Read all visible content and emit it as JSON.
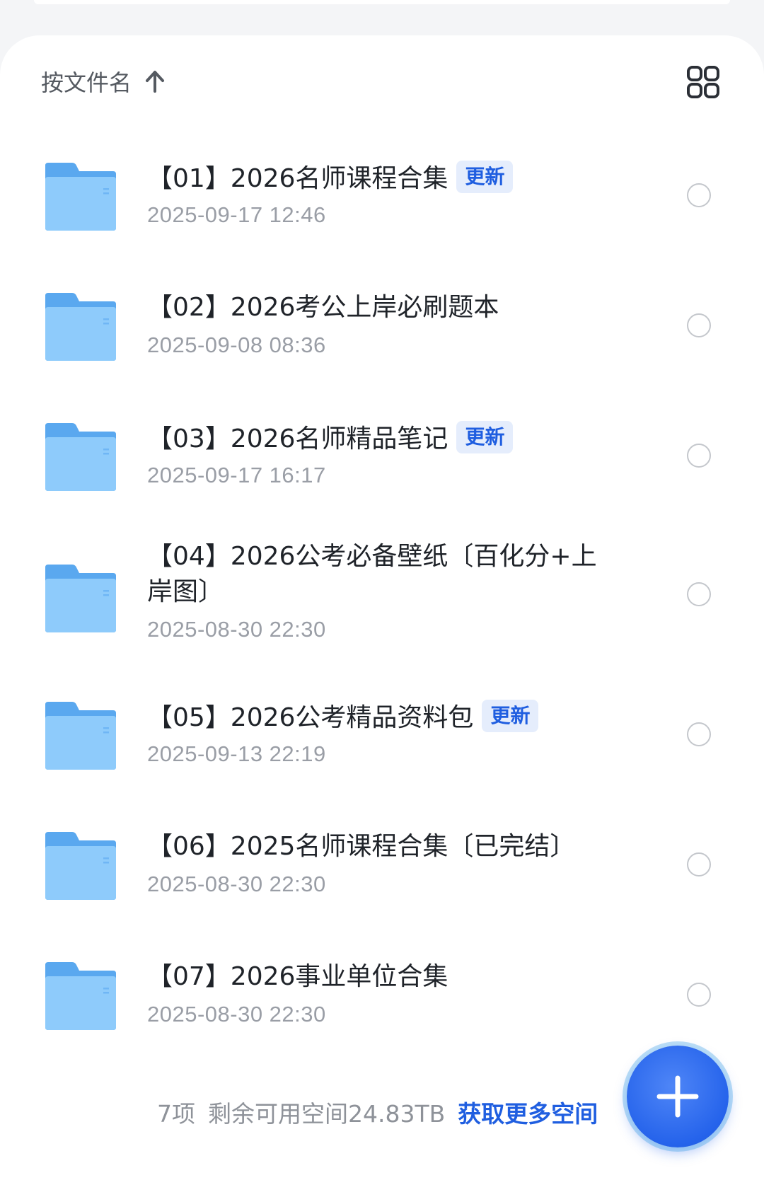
{
  "sort": {
    "label": "按文件名"
  },
  "files": [
    {
      "title": "【01】2026名师课程合集",
      "badge": "更新",
      "date": "2025-09-17 12:46"
    },
    {
      "title": "【02】2026考公上岸必刷题本",
      "badge": "",
      "date": "2025-09-08 08:36"
    },
    {
      "title": "【03】2026名师精品笔记",
      "badge": "更新",
      "date": "2025-09-17 16:17"
    },
    {
      "title": "【04】2026公考必备壁纸〔百化分+上岸图〕",
      "badge": "",
      "date": "2025-08-30 22:30"
    },
    {
      "title": "【05】2026公考精品资料包",
      "badge": "更新",
      "date": "2025-09-13 22:19"
    },
    {
      "title": "【06】2025名师课程合集〔已完结〕",
      "badge": "",
      "date": "2025-08-30 22:30"
    },
    {
      "title": "【07】2026事业单位合集",
      "badge": "",
      "date": "2025-08-30 22:30"
    }
  ],
  "footer": {
    "count": "7项",
    "space": "剩余可用空间24.83TB",
    "more_link": "获取更多空间"
  },
  "colors": {
    "accent": "#1f5ee0",
    "folder": "#6fb6f5"
  },
  "icons": {
    "sort": "arrow-up-icon",
    "view": "grid-view-icon",
    "folder": "folder-icon",
    "fab": "plus-icon"
  }
}
